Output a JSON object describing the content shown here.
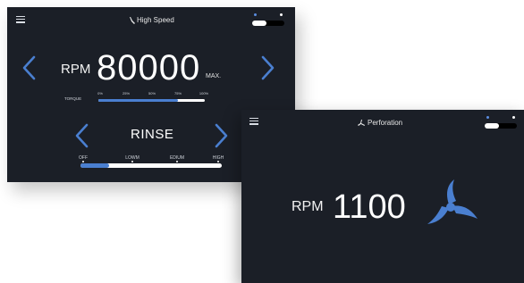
{
  "high_speed_screen": {
    "title": "High Speed",
    "menu_icon": "hamburger-icon",
    "title_icon": "spindle-icon",
    "rpm_label": "RPM",
    "rpm_value": "80000",
    "max_label": "MAX.",
    "torque": {
      "label": "TORQUE",
      "ticks": [
        "0%",
        "25%",
        "50%",
        "75%",
        "100%"
      ],
      "level_percent": 75
    },
    "mode": {
      "label": "RINSE",
      "flow_ticks": [
        "OFF",
        "LOWM",
        "EDIUM",
        "HIGH"
      ],
      "level_fraction": 0.2
    },
    "toggle_on": true,
    "colors": {
      "accent": "#4a7fd0",
      "background": "#1b1f27"
    }
  },
  "perforation_screen": {
    "title": "Perforation",
    "menu_icon": "hamburger-icon",
    "title_icon": "perforation-icon",
    "rpm_label": "RPM",
    "rpm_value": "1100",
    "fan_icon": "rotation-icon",
    "toggle_on": true
  }
}
